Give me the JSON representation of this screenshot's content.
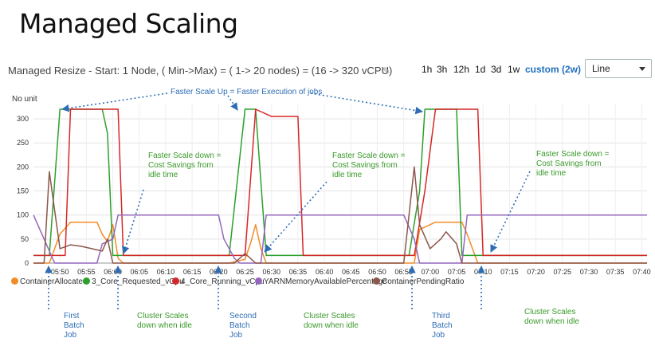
{
  "slide": {
    "title": "Managed Scaling"
  },
  "widget": {
    "title": "Managed Resize - Start: 1 Node, ( Min->Max) = ( 1-> 20 nodes) = (16 -> 320 vCPU)",
    "edit_icon": "pencil-icon",
    "ranges": [
      "1h",
      "3h",
      "12h",
      "1d",
      "3d",
      "1w",
      "custom (2w)"
    ],
    "active_range": "custom (2w)",
    "chart_type_select": "Line"
  },
  "colors": {
    "ContainerAllocated": "#f28c28",
    "3_Core_Requested_vCpu": "#2ca02c",
    "4_Core_Running_vCpu": "#d62728",
    "YARNMemoryAvailablePercentage": "#9467bd",
    "ContainerPendingRatio": "#8c564b",
    "annotation_blue": "#2e6db4",
    "annotation_green": "#3a9a2a"
  },
  "annotations": {
    "scale_up": "Faster Scale Up =  Faster Execution of jobs",
    "scale_down_1": [
      "Faster Scale down =",
      "Cost Savings from",
      "idle time"
    ],
    "scale_down_2": [
      "Faster Scale down =",
      "Cost Savings from",
      "idle time"
    ],
    "scale_down_3": [
      "Faster Scale down =",
      "Cost Savings from",
      "idle time"
    ],
    "batch_1": [
      "First",
      "Batch",
      "Job"
    ],
    "idle_1": [
      "Cluster Scales",
      "down when idle"
    ],
    "batch_2": [
      "Second",
      "Batch",
      "Job"
    ],
    "idle_2": [
      "Cluster Scales",
      "down when idle"
    ],
    "batch_3": [
      "Third",
      "Batch",
      "Job"
    ],
    "idle_3": [
      "Cluster Scales",
      "down when idle"
    ]
  },
  "chart_data": {
    "type": "line",
    "ylabel": "No unit",
    "ylim": [
      0,
      330
    ],
    "yticks": [
      0,
      50,
      100,
      150,
      200,
      250,
      300
    ],
    "xlim": [
      "05:45",
      "07:41"
    ],
    "xticks": [
      "05:50",
      "05:55",
      "06:00",
      "06:05",
      "06:10",
      "06:15",
      "06:20",
      "06:25",
      "06:30",
      "06:35",
      "06:40",
      "06:45",
      "06:50",
      "06:55",
      "07:00",
      "07:05",
      "07:10",
      "07:15",
      "07:20",
      "07:25",
      "07:30",
      "07:35",
      "07:40"
    ],
    "grid": true,
    "legend_position": "bottom",
    "series": [
      {
        "name": "ContainerAllocated",
        "points": [
          [
            "05:45",
            0
          ],
          [
            "05:48",
            0
          ],
          [
            "05:50",
            60
          ],
          [
            "05:52",
            85
          ],
          [
            "05:57",
            85
          ],
          [
            "05:58",
            60
          ],
          [
            "05:59",
            45
          ],
          [
            "06:00",
            80
          ],
          [
            "06:01",
            10
          ],
          [
            "06:02",
            0
          ],
          [
            "06:22",
            0
          ],
          [
            "06:25",
            8
          ],
          [
            "06:26",
            40
          ],
          [
            "06:27",
            80
          ],
          [
            "06:28",
            30
          ],
          [
            "06:29",
            0
          ],
          [
            "06:57",
            0
          ],
          [
            "06:58",
            70
          ],
          [
            "07:01",
            85
          ],
          [
            "07:06",
            85
          ],
          [
            "07:07",
            60
          ],
          [
            "07:08",
            30
          ],
          [
            "07:09",
            0
          ],
          [
            "07:41",
            0
          ]
        ]
      },
      {
        "name": "3_Core_Requested_vCpu",
        "points": [
          [
            "05:45",
            16
          ],
          [
            "05:48",
            16
          ],
          [
            "05:50",
            320
          ],
          [
            "05:58",
            320
          ],
          [
            "05:59",
            270
          ],
          [
            "06:00",
            16
          ],
          [
            "06:02",
            16
          ],
          [
            "06:22",
            16
          ],
          [
            "06:25",
            320
          ],
          [
            "06:27",
            320
          ],
          [
            "06:29",
            16
          ],
          [
            "06:56",
            16
          ],
          [
            "06:58",
            150
          ],
          [
            "06:59",
            320
          ],
          [
            "07:05",
            320
          ],
          [
            "07:06",
            16
          ],
          [
            "07:41",
            16
          ]
        ]
      },
      {
        "name": "4_Core_Running_vCpu",
        "points": [
          [
            "05:45",
            16
          ],
          [
            "05:51",
            16
          ],
          [
            "05:52",
            320
          ],
          [
            "06:01",
            320
          ],
          [
            "06:02",
            16
          ],
          [
            "06:25",
            16
          ],
          [
            "06:27",
            320
          ],
          [
            "06:28",
            315
          ],
          [
            "06:30",
            305
          ],
          [
            "06:35",
            305
          ],
          [
            "06:36",
            16
          ],
          [
            "06:57",
            16
          ],
          [
            "06:59",
            150
          ],
          [
            "07:01",
            320
          ],
          [
            "07:09",
            320
          ],
          [
            "07:10",
            16
          ],
          [
            "07:41",
            16
          ]
        ]
      },
      {
        "name": "YARNMemoryAvailablePercentage",
        "points": [
          [
            "05:45",
            100
          ],
          [
            "05:47",
            50
          ],
          [
            "05:49",
            0
          ],
          [
            "05:57",
            0
          ],
          [
            "05:58",
            40
          ],
          [
            "06:00",
            50
          ],
          [
            "06:01",
            100
          ],
          [
            "06:20",
            100
          ],
          [
            "06:21",
            50
          ],
          [
            "06:23",
            10
          ],
          [
            "06:24",
            0
          ],
          [
            "06:28",
            0
          ],
          [
            "06:29",
            100
          ],
          [
            "06:55",
            100
          ],
          [
            "06:57",
            50
          ],
          [
            "06:58",
            0
          ],
          [
            "07:06",
            0
          ],
          [
            "07:07",
            100
          ],
          [
            "07:41",
            100
          ]
        ]
      },
      {
        "name": "ContainerPendingRatio",
        "points": [
          [
            "05:45",
            0
          ],
          [
            "05:47",
            0
          ],
          [
            "05:48",
            190
          ],
          [
            "05:50",
            30
          ],
          [
            "05:52",
            38
          ],
          [
            "05:54",
            35
          ],
          [
            "05:56",
            30
          ],
          [
            "05:58",
            25
          ],
          [
            "05:59",
            50
          ],
          [
            "06:00",
            0
          ],
          [
            "06:23",
            0
          ],
          [
            "06:25",
            20
          ],
          [
            "06:27",
            0
          ],
          [
            "06:55",
            0
          ],
          [
            "06:57",
            200
          ],
          [
            "06:58",
            80
          ],
          [
            "07:00",
            30
          ],
          [
            "07:02",
            50
          ],
          [
            "07:03",
            65
          ],
          [
            "07:05",
            40
          ],
          [
            "07:06",
            0
          ],
          [
            "07:41",
            0
          ]
        ]
      }
    ]
  }
}
